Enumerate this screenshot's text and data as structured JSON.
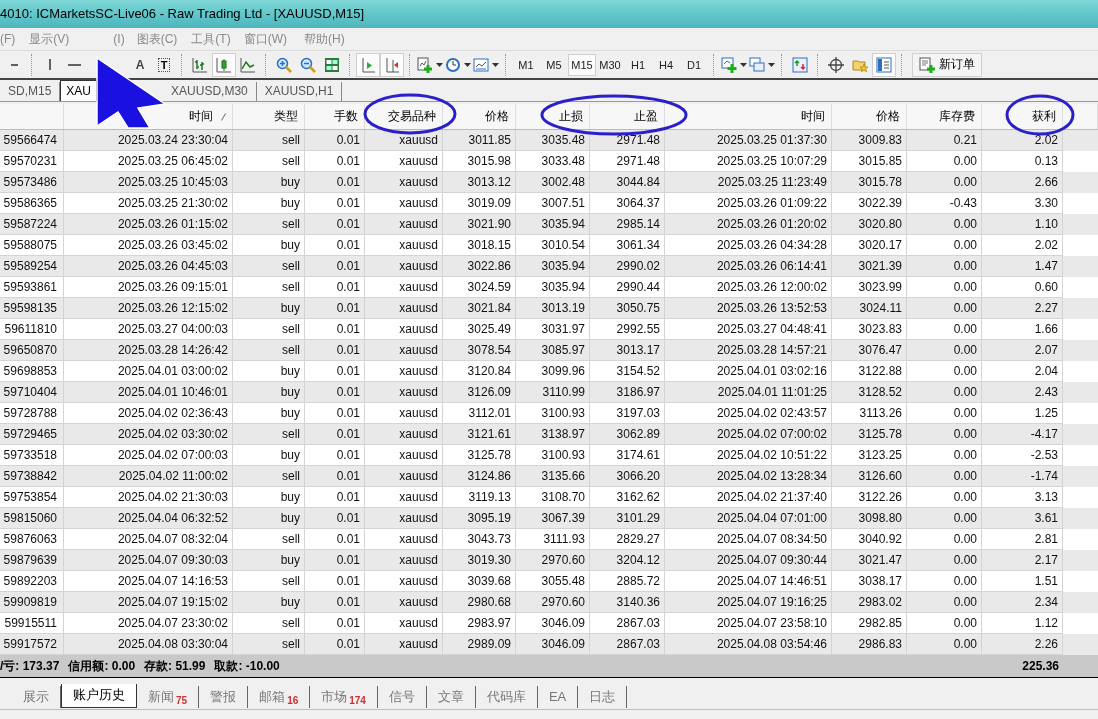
{
  "window": {
    "title": "4010: ICMarketsSC-Live06 - Raw Trading Ltd - [XAUUSD,M15]"
  },
  "menu": [
    "(F)",
    "显示(V)",
    "(I)",
    "图表(C)",
    "工具(T)",
    "窗口(W)",
    "帮助(H)"
  ],
  "toolbar": {
    "tools": [
      {
        "kind": "dash",
        "pressed": false
      },
      {
        "kind": "vline",
        "pressed": false
      },
      {
        "kind": "hline",
        "pressed": false
      },
      {
        "kind": "text",
        "label": "A",
        "pressed": false
      },
      {
        "kind": "textbox",
        "label": "T",
        "pressed": false
      },
      {
        "kind": "bars",
        "pressed": false
      },
      {
        "kind": "candles",
        "pressed": true
      },
      {
        "kind": "linechart",
        "pressed": false
      },
      {
        "kind": "zoomin",
        "pressed": false
      },
      {
        "kind": "zoomout",
        "pressed": false
      },
      {
        "kind": "tile",
        "pressed": false
      },
      {
        "kind": "autoscroll",
        "pressed": true
      },
      {
        "kind": "shift",
        "pressed": true
      },
      {
        "kind": "newchart",
        "pressed": false
      },
      {
        "kind": "clock",
        "pressed": false
      },
      {
        "kind": "template",
        "pressed": false
      }
    ],
    "timeframes": [
      {
        "label": "M1",
        "selected": false
      },
      {
        "label": "M5",
        "selected": false
      },
      {
        "label": "M15",
        "selected": true
      },
      {
        "label": "M30",
        "selected": false
      },
      {
        "label": "H1",
        "selected": false
      },
      {
        "label": "H4",
        "selected": false
      },
      {
        "label": "D1",
        "selected": false
      }
    ],
    "tools2": [
      {
        "kind": "addindicator",
        "pressed": false
      },
      {
        "kind": "windows",
        "pressed": false
      },
      {
        "kind": "marketwatch",
        "pressed": false
      },
      {
        "kind": "crosshair",
        "pressed": false
      },
      {
        "kind": "folderstar",
        "pressed": false
      },
      {
        "kind": "navigator",
        "pressed": true
      }
    ],
    "new_order": "新订单"
  },
  "chart_tabs": [
    {
      "label": "SD,M15",
      "selected": false
    },
    {
      "label": "XAU",
      "selected": true
    },
    {
      "label": "XAUUSD,M30",
      "selected": false
    },
    {
      "label": "XAUUSD,H1",
      "selected": false
    }
  ],
  "table": {
    "columns": [
      "",
      "时间",
      "类型",
      "手数",
      "交易品种",
      "价格",
      "止损",
      "止盈",
      "时间",
      "价格",
      "库存费",
      "获利"
    ],
    "rows": [
      [
        "59566474",
        "2025.03.24 23:30:04",
        "sell",
        "0.01",
        "xauusd",
        "3011.85",
        "3035.48",
        "2971.48",
        "2025.03.25 01:37:30",
        "3009.83",
        "0.21",
        "2.02"
      ],
      [
        "59570231",
        "2025.03.25 06:45:02",
        "sell",
        "0.01",
        "xauusd",
        "3015.98",
        "3033.48",
        "2971.48",
        "2025.03.25 10:07:29",
        "3015.85",
        "0.00",
        "0.13"
      ],
      [
        "59573486",
        "2025.03.25 10:45:03",
        "buy",
        "0.01",
        "xauusd",
        "3013.12",
        "3002.48",
        "3044.84",
        "2025.03.25 11:23:49",
        "3015.78",
        "0.00",
        "2.66"
      ],
      [
        "59586365",
        "2025.03.25 21:30:02",
        "buy",
        "0.01",
        "xauusd",
        "3019.09",
        "3007.51",
        "3064.37",
        "2025.03.26 01:09:22",
        "3022.39",
        "-0.43",
        "3.30"
      ],
      [
        "59587224",
        "2025.03.26 01:15:02",
        "sell",
        "0.01",
        "xauusd",
        "3021.90",
        "3035.94",
        "2985.14",
        "2025.03.26 01:20:02",
        "3020.80",
        "0.00",
        "1.10"
      ],
      [
        "59588075",
        "2025.03.26 03:45:02",
        "buy",
        "0.01",
        "xauusd",
        "3018.15",
        "3010.54",
        "3061.34",
        "2025.03.26 04:34:28",
        "3020.17",
        "0.00",
        "2.02"
      ],
      [
        "59589254",
        "2025.03.26 04:45:03",
        "sell",
        "0.01",
        "xauusd",
        "3022.86",
        "3035.94",
        "2990.02",
        "2025.03.26 06:14:41",
        "3021.39",
        "0.00",
        "1.47"
      ],
      [
        "59593861",
        "2025.03.26 09:15:01",
        "sell",
        "0.01",
        "xauusd",
        "3024.59",
        "3035.94",
        "2990.44",
        "2025.03.26 12:00:02",
        "3023.99",
        "0.00",
        "0.60"
      ],
      [
        "59598135",
        "2025.03.26 12:15:02",
        "buy",
        "0.01",
        "xauusd",
        "3021.84",
        "3013.19",
        "3050.75",
        "2025.03.26 13:52:53",
        "3024.11",
        "0.00",
        "2.27"
      ],
      [
        "59611810",
        "2025.03.27 04:00:03",
        "sell",
        "0.01",
        "xauusd",
        "3025.49",
        "3031.97",
        "2992.55",
        "2025.03.27 04:48:41",
        "3023.83",
        "0.00",
        "1.66"
      ],
      [
        "59650870",
        "2025.03.28 14:26:42",
        "sell",
        "0.01",
        "xauusd",
        "3078.54",
        "3085.97",
        "3013.17",
        "2025.03.28 14:57:21",
        "3076.47",
        "0.00",
        "2.07"
      ],
      [
        "59698853",
        "2025.04.01 03:00:02",
        "buy",
        "0.01",
        "xauusd",
        "3120.84",
        "3099.96",
        "3154.52",
        "2025.04.01 03:02:16",
        "3122.88",
        "0.00",
        "2.04"
      ],
      [
        "59710404",
        "2025.04.01 10:46:01",
        "buy",
        "0.01",
        "xauusd",
        "3126.09",
        "3110.99",
        "3186.97",
        "2025.04.01 11:01:25",
        "3128.52",
        "0.00",
        "2.43"
      ],
      [
        "59728788",
        "2025.04.02 02:36:43",
        "buy",
        "0.01",
        "xauusd",
        "3112.01",
        "3100.93",
        "3197.03",
        "2025.04.02 02:43:57",
        "3113.26",
        "0.00",
        "1.25"
      ],
      [
        "59729465",
        "2025.04.02 03:30:02",
        "sell",
        "0.01",
        "xauusd",
        "3121.61",
        "3138.97",
        "3062.89",
        "2025.04.02 07:00:02",
        "3125.78",
        "0.00",
        "-4.17"
      ],
      [
        "59733518",
        "2025.04.02 07:00:03",
        "buy",
        "0.01",
        "xauusd",
        "3125.78",
        "3100.93",
        "3174.61",
        "2025.04.02 10:51:22",
        "3123.25",
        "0.00",
        "-2.53"
      ],
      [
        "59738842",
        "2025.04.02 11:00:02",
        "sell",
        "0.01",
        "xauusd",
        "3124.86",
        "3135.66",
        "3066.20",
        "2025.04.02 13:28:34",
        "3126.60",
        "0.00",
        "-1.74"
      ],
      [
        "59753854",
        "2025.04.02 21:30:03",
        "buy",
        "0.01",
        "xauusd",
        "3119.13",
        "3108.70",
        "3162.62",
        "2025.04.02 21:37:40",
        "3122.26",
        "0.00",
        "3.13"
      ],
      [
        "59815060",
        "2025.04.04 06:32:52",
        "buy",
        "0.01",
        "xauusd",
        "3095.19",
        "3067.39",
        "3101.29",
        "2025.04.04 07:01:00",
        "3098.80",
        "0.00",
        "3.61"
      ],
      [
        "59876063",
        "2025.04.07 08:32:04",
        "sell",
        "0.01",
        "xauusd",
        "3043.73",
        "3111.93",
        "2829.27",
        "2025.04.07 08:34:50",
        "3040.92",
        "0.00",
        "2.81"
      ],
      [
        "59879639",
        "2025.04.07 09:30:03",
        "buy",
        "0.01",
        "xauusd",
        "3019.30",
        "2970.60",
        "3204.12",
        "2025.04.07 09:30:44",
        "3021.47",
        "0.00",
        "2.17"
      ],
      [
        "59892203",
        "2025.04.07 14:16:53",
        "sell",
        "0.01",
        "xauusd",
        "3039.68",
        "3055.48",
        "2885.72",
        "2025.04.07 14:46:51",
        "3038.17",
        "0.00",
        "1.51"
      ],
      [
        "59909819",
        "2025.04.07 19:15:02",
        "buy",
        "0.01",
        "xauusd",
        "2980.68",
        "2970.60",
        "3140.36",
        "2025.04.07 19:16:25",
        "2983.02",
        "0.00",
        "2.34"
      ],
      [
        "59915511",
        "2025.04.07 23:30:02",
        "sell",
        "0.01",
        "xauusd",
        "2983.97",
        "3046.09",
        "2867.03",
        "2025.04.07 23:58:10",
        "2982.85",
        "0.00",
        "1.12"
      ],
      [
        "59917572",
        "2025.04.08 03:30:04",
        "sell",
        "0.01",
        "xauusd",
        "2989.09",
        "3046.09",
        "2867.03",
        "2025.04.08 03:54:46",
        "2986.83",
        "0.00",
        "2.26"
      ]
    ]
  },
  "summary": {
    "items": [
      "/亏: 173.37",
      "信用额: 0.00",
      "存款: 51.99",
      "取款: -10.00"
    ],
    "total": "225.36"
  },
  "terminal_tabs": [
    {
      "label": "展示",
      "selected": false
    },
    {
      "label": "账户历史",
      "selected": true
    },
    {
      "label": "新闻",
      "badge": "75",
      "selected": false
    },
    {
      "label": "警报",
      "selected": false
    },
    {
      "label": "邮箱",
      "badge": "16",
      "selected": false
    },
    {
      "label": "市场",
      "badge": "174",
      "selected": false
    },
    {
      "label": "信号",
      "selected": false
    },
    {
      "label": "文章",
      "selected": false
    },
    {
      "label": "代码库",
      "selected": false
    },
    {
      "label": "EA",
      "selected": false
    },
    {
      "label": "日志",
      "selected": false
    }
  ]
}
